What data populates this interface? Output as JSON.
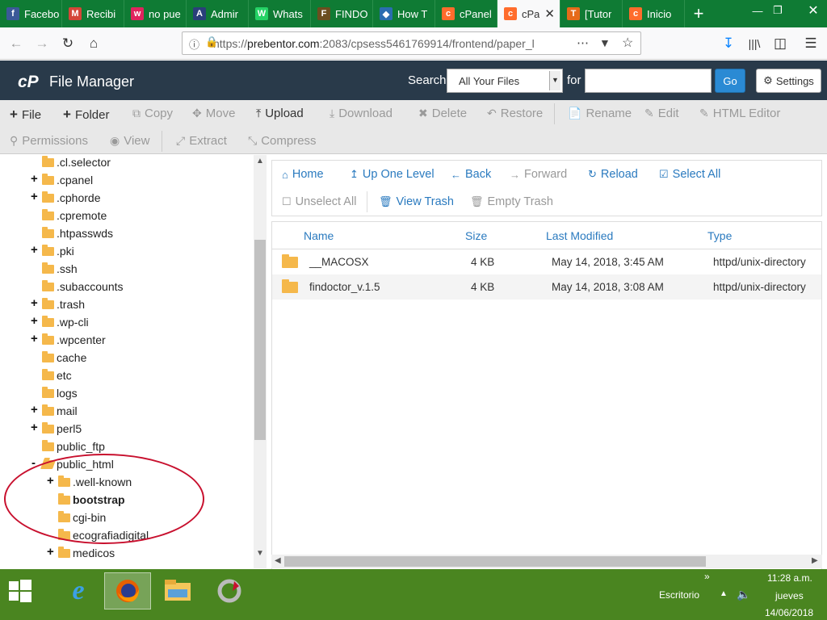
{
  "browser": {
    "tabs": [
      {
        "label": "Facebo",
        "icon": "facebook-icon",
        "color": "#3b5998",
        "glyph": "f"
      },
      {
        "label": "Recibi",
        "icon": "gmail-icon",
        "color": "#d44638",
        "glyph": "M"
      },
      {
        "label": "no pue",
        "icon": "wallapop-icon",
        "color": "#e0245e",
        "glyph": "w"
      },
      {
        "label": "Admir",
        "icon": "admin-icon",
        "color": "#2a3f7a",
        "glyph": "A"
      },
      {
        "label": "Whats",
        "icon": "whatsapp-icon",
        "color": "#25d366",
        "glyph": "W"
      },
      {
        "label": "FINDO",
        "icon": "findo-icon",
        "color": "#6b4e1f",
        "glyph": "F"
      },
      {
        "label": "How T",
        "icon": "diamond-icon",
        "color": "#2a6db0",
        "glyph": "◆"
      },
      {
        "label": "cPanel",
        "icon": "cpanel-icon",
        "color": "#ff6c2c",
        "glyph": "c"
      },
      {
        "label": "cPa",
        "icon": "cpanel-icon",
        "color": "#ff6c2c",
        "glyph": "c",
        "active": true
      },
      {
        "label": "[Tutor",
        "icon": "tutor-icon",
        "color": "#e66b1a",
        "glyph": "T"
      },
      {
        "label": "Inicio",
        "icon": "cpanel-icon",
        "color": "#ff6c2c",
        "glyph": "c"
      }
    ],
    "url_prefix": "https://",
    "url_domain": "prebentor.com",
    "url_rest": ":2083/cpsess5461769914/frontend/paper_l"
  },
  "header": {
    "logo": "cP",
    "title": "File Manager",
    "search_label": "Search",
    "search_scope": "All Your Files",
    "for_label": "for",
    "search_value": "",
    "go_label": "Go",
    "settings_label": "Settings"
  },
  "toolbar": {
    "file": "File",
    "folder": "Folder",
    "copy": "Copy",
    "move": "Move",
    "upload": "Upload",
    "download": "Download",
    "delete": "Delete",
    "restore": "Restore",
    "rename": "Rename",
    "edit": "Edit",
    "html_editor": "HTML Editor",
    "permissions": "Permissions",
    "view": "View",
    "extract": "Extract",
    "compress": "Compress"
  },
  "tree": [
    {
      "label": ".cl.selector",
      "expandable": false,
      "depth": 0
    },
    {
      "label": ".cpanel",
      "expandable": true,
      "depth": 0
    },
    {
      "label": ".cphorde",
      "expandable": true,
      "depth": 0
    },
    {
      "label": ".cpremote",
      "expandable": false,
      "depth": 0
    },
    {
      "label": ".htpasswds",
      "expandable": false,
      "depth": 0
    },
    {
      "label": ".pki",
      "expandable": true,
      "depth": 0
    },
    {
      "label": ".ssh",
      "expandable": false,
      "depth": 0
    },
    {
      "label": ".subaccounts",
      "expandable": false,
      "depth": 0
    },
    {
      "label": ".trash",
      "expandable": true,
      "depth": 0
    },
    {
      "label": ".wp-cli",
      "expandable": true,
      "depth": 0
    },
    {
      "label": ".wpcenter",
      "expandable": true,
      "depth": 0
    },
    {
      "label": "cache",
      "expandable": false,
      "depth": 0
    },
    {
      "label": "etc",
      "expandable": false,
      "depth": 0
    },
    {
      "label": "logs",
      "expandable": false,
      "depth": 0
    },
    {
      "label": "mail",
      "expandable": true,
      "depth": 0
    },
    {
      "label": "perl5",
      "expandable": true,
      "depth": 0
    },
    {
      "label": "public_ftp",
      "expandable": false,
      "depth": 0
    },
    {
      "label": "public_html",
      "expandable": "open",
      "depth": 0
    },
    {
      "label": ".well-known",
      "expandable": true,
      "depth": 1
    },
    {
      "label": "bootstrap",
      "expandable": false,
      "depth": 1,
      "bold": true
    },
    {
      "label": "cgi-bin",
      "expandable": false,
      "depth": 1
    },
    {
      "label": "ecografiadigital",
      "expandable": false,
      "depth": 1
    },
    {
      "label": "medicos",
      "expandable": true,
      "depth": 1
    }
  ],
  "filenav": {
    "home": "Home",
    "up": "Up One Level",
    "back": "Back",
    "forward": "Forward",
    "reload": "Reload",
    "select_all": "Select All",
    "unselect_all": "Unselect All",
    "view_trash": "View Trash",
    "empty_trash": "Empty Trash"
  },
  "filelist": {
    "columns": [
      "Name",
      "Size",
      "Last Modified",
      "Type"
    ],
    "rows": [
      {
        "name": "__MACOSX",
        "size": "4 KB",
        "modified": "May 14, 2018, 3:45 AM",
        "type": "httpd/unix-directory"
      },
      {
        "name": "findoctor_v.1.5",
        "size": "4 KB",
        "modified": "May 14, 2018, 3:08 AM",
        "type": "httpd/unix-directory"
      }
    ]
  },
  "taskbar": {
    "language": "Escritorio",
    "time": "11:28 a.m.",
    "day": "jueves",
    "date": "14/06/2018"
  },
  "colors": {
    "accent": "#2a7abf",
    "header_bg": "#293a4a",
    "taskbar_bg": "#4a8520",
    "tab_bar_bg": "#0f7b34",
    "folder": "#f5b84b",
    "annotation": "#c8102e"
  }
}
